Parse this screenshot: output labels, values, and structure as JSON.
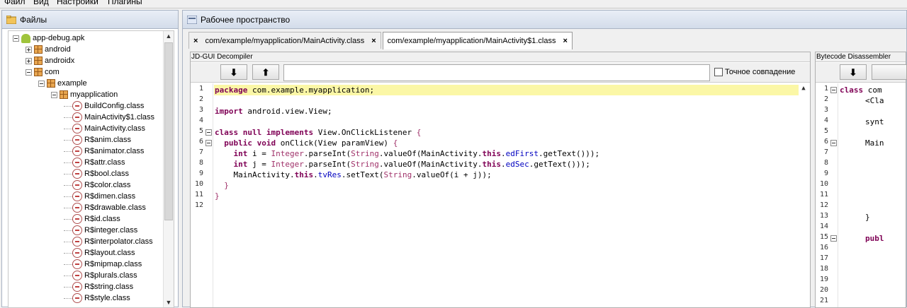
{
  "menu": [
    "Файл",
    "Вид",
    "Настройки",
    "Плагины"
  ],
  "files_panel": {
    "title": "Файлы",
    "tree": [
      {
        "label": "app-debug.apk",
        "type": "apk",
        "level": 0,
        "exp": "minus"
      },
      {
        "label": "android",
        "type": "pkg",
        "level": 1,
        "exp": "plus"
      },
      {
        "label": "androidx",
        "type": "pkg",
        "level": 1,
        "exp": "plus"
      },
      {
        "label": "com",
        "type": "pkg",
        "level": 1,
        "exp": "minus"
      },
      {
        "label": "example",
        "type": "pkg",
        "level": 2,
        "exp": "minus"
      },
      {
        "label": "myapplication",
        "type": "pkg",
        "level": 3,
        "exp": "minus"
      },
      {
        "label": "BuildConfig.class",
        "type": "class",
        "level": 4
      },
      {
        "label": "MainActivity$1.class",
        "type": "class",
        "level": 4
      },
      {
        "label": "MainActivity.class",
        "type": "class",
        "level": 4
      },
      {
        "label": "R$anim.class",
        "type": "class",
        "level": 4
      },
      {
        "label": "R$animator.class",
        "type": "class",
        "level": 4
      },
      {
        "label": "R$attr.class",
        "type": "class",
        "level": 4
      },
      {
        "label": "R$bool.class",
        "type": "class",
        "level": 4
      },
      {
        "label": "R$color.class",
        "type": "class",
        "level": 4
      },
      {
        "label": "R$dimen.class",
        "type": "class",
        "level": 4
      },
      {
        "label": "R$drawable.class",
        "type": "class",
        "level": 4
      },
      {
        "label": "R$id.class",
        "type": "class",
        "level": 4
      },
      {
        "label": "R$integer.class",
        "type": "class",
        "level": 4
      },
      {
        "label": "R$interpolator.class",
        "type": "class",
        "level": 4
      },
      {
        "label": "R$layout.class",
        "type": "class",
        "level": 4
      },
      {
        "label": "R$mipmap.class",
        "type": "class",
        "level": 4
      },
      {
        "label": "R$plurals.class",
        "type": "class",
        "level": 4
      },
      {
        "label": "R$string.class",
        "type": "class",
        "level": 4
      },
      {
        "label": "R$style.class",
        "type": "class",
        "level": 4
      }
    ]
  },
  "workspace": {
    "title": "Рабочее пространство",
    "tabs": [
      {
        "label": "com/example/myapplication/MainActivity.class",
        "active": false
      },
      {
        "label": "com/example/myapplication/MainActivity$1.class",
        "active": true
      }
    ],
    "decompiler": {
      "title": "JD-GUI Decompiler",
      "download_icon": "⬇",
      "upload_icon": "⬆",
      "search_value": "",
      "exact_match_label": "Точное совпадение",
      "lines": [
        "1",
        "2",
        "3",
        "4",
        "5",
        "6",
        "7",
        "8",
        "9",
        "10",
        "11",
        "12"
      ]
    },
    "bytecode": {
      "title": "Bytecode Disassembler",
      "download_icon": "⬇",
      "lines": [
        "1",
        "2",
        "3",
        "4",
        "5",
        "6",
        "7",
        "8",
        "9",
        "10",
        "11",
        "12",
        "13",
        "14",
        "15",
        "16",
        "17",
        "18",
        "19",
        "20",
        "21"
      ],
      "code": {
        "l1": "class com",
        "l2": "<Cla",
        "l4": "synt",
        "l6": "Main",
        "l13": "}",
        "l15": "publ"
      }
    }
  }
}
